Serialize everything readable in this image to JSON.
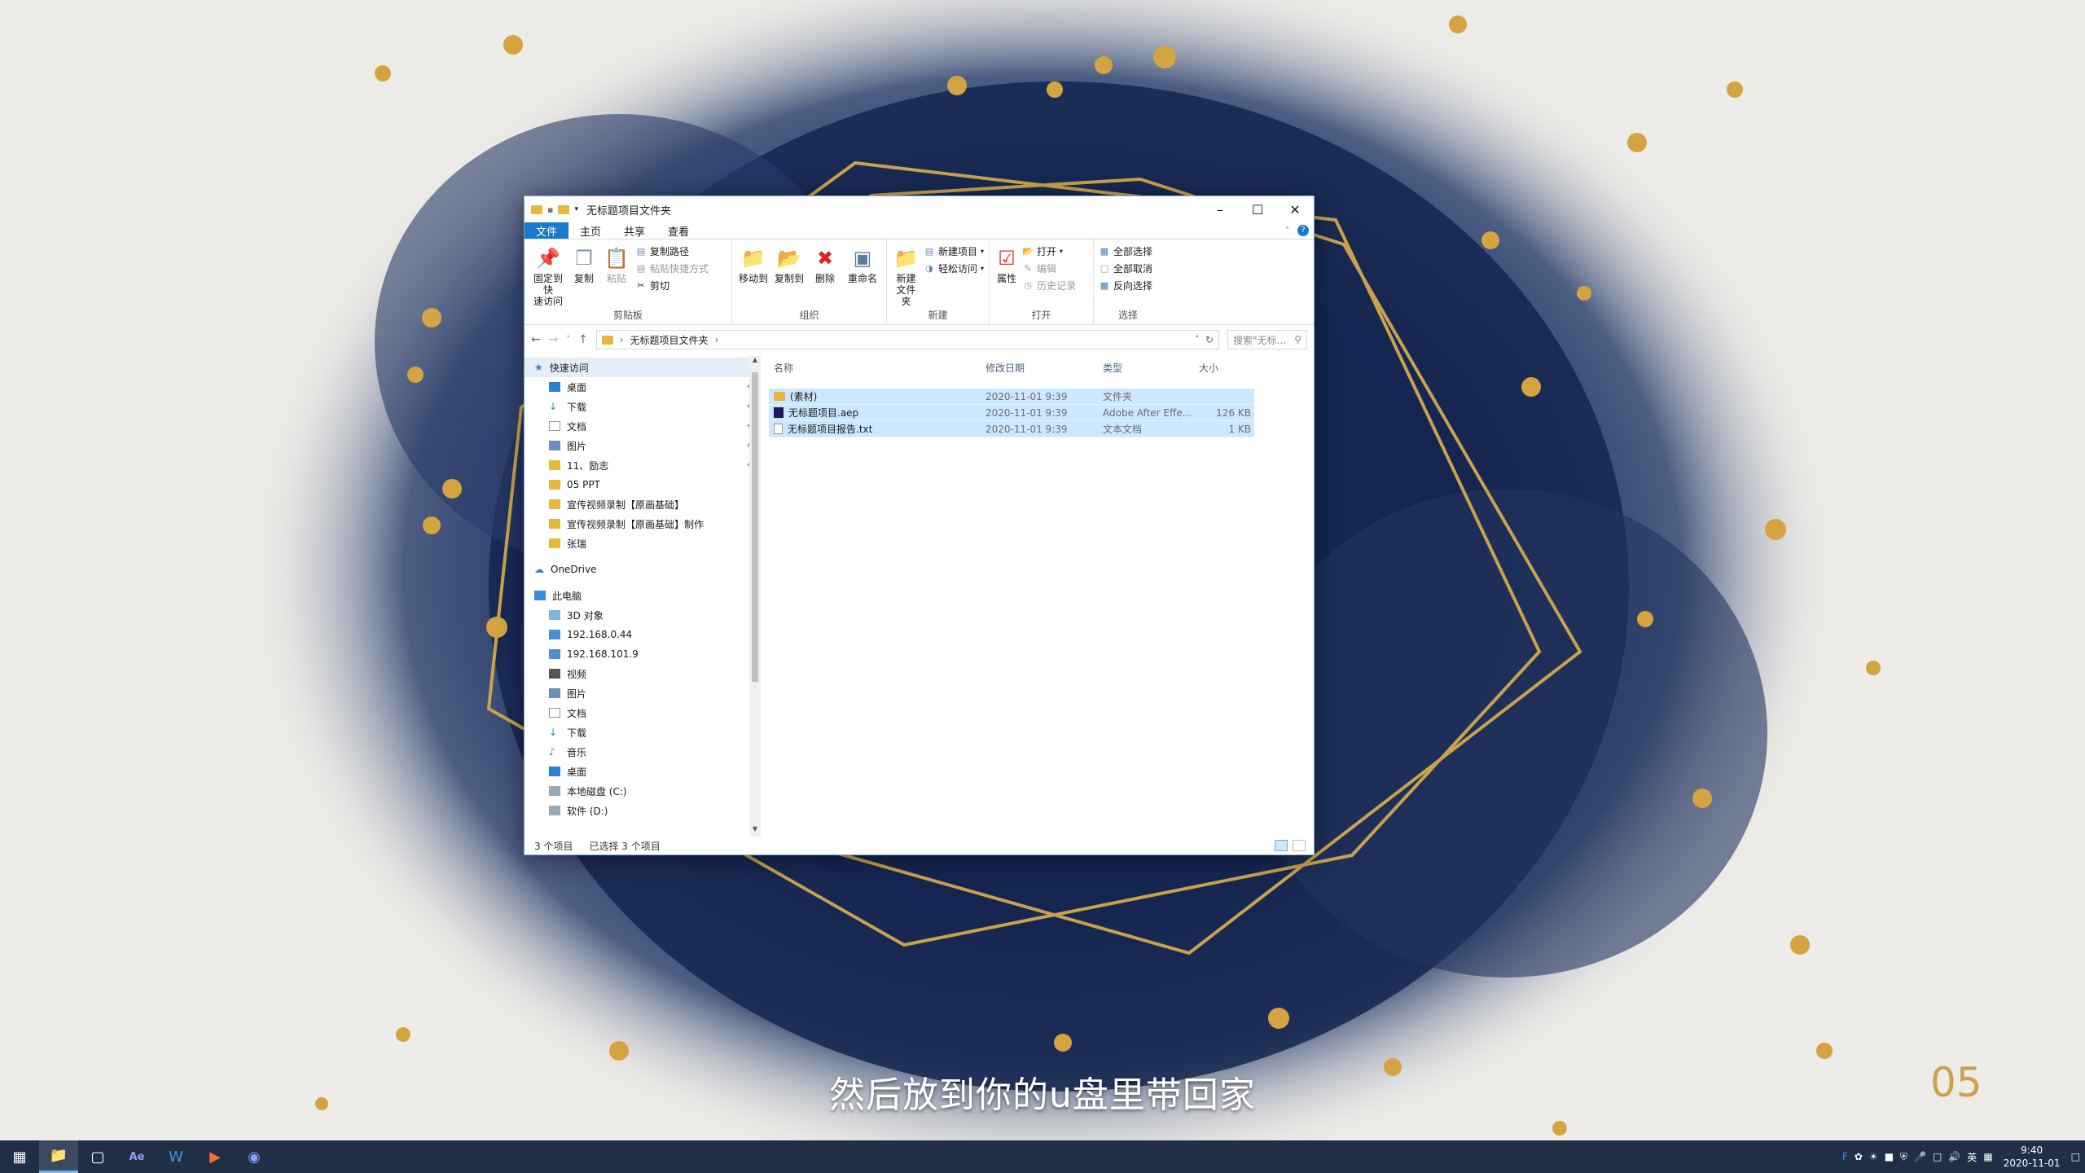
{
  "window": {
    "title": "无标题项目文件夹",
    "tabs": [
      "文件",
      "主页",
      "共享",
      "查看"
    ]
  },
  "ribbon": {
    "clipboard": {
      "label": "剪贴板",
      "pin": "固定到快\n速访问",
      "copy": "复制",
      "paste": "粘贴",
      "copy_path": "复制路径",
      "paste_shortcut": "粘贴快捷方式",
      "cut": "剪切"
    },
    "organize": {
      "label": "组织",
      "move_to": "移动到",
      "copy_to": "复制到",
      "delete": "删除",
      "rename": "重命名"
    },
    "new": {
      "label": "新建",
      "new_folder": "新建\n文件夹",
      "new_item": "新建项目",
      "easy_access": "轻松访问"
    },
    "open": {
      "label": "打开",
      "properties": "属性",
      "open": "打开",
      "edit": "编辑",
      "history": "历史记录"
    },
    "select": {
      "label": "选择",
      "select_all": "全部选择",
      "select_none": "全部取消",
      "invert": "反向选择"
    }
  },
  "address": {
    "path": "无标题项目文件夹",
    "search_placeholder": "搜索\"无标..."
  },
  "nav": {
    "quick_access": "快速访问",
    "quick_items": [
      "桌面",
      "下载",
      "文档",
      "图片",
      "11、励志",
      "05 PPT",
      "宣传视频录制【原画基础】",
      "宣传视频录制【原画基础】制作",
      "张瑞"
    ],
    "onedrive": "OneDrive",
    "this_pc": "此电脑",
    "pc_items": [
      "3D 对象",
      "192.168.0.44",
      "192.168.101.9",
      "视频",
      "图片",
      "文档",
      "下载",
      "音乐",
      "桌面",
      "本地磁盘 (C:)",
      "软件 (D:)"
    ]
  },
  "columns": {
    "name": "名称",
    "date": "修改日期",
    "type": "类型",
    "size": "大小"
  },
  "files": [
    {
      "name": "(素材)",
      "date": "2020-11-01 9:39",
      "type": "文件夹",
      "size": "",
      "icon": "folder-icon"
    },
    {
      "name": "无标题项目.aep",
      "date": "2020-11-01 9:39",
      "type": "Adobe After Effe...",
      "size": "126 KB",
      "icon": "aep-file-icon"
    },
    {
      "name": "无标题项目报告.txt",
      "date": "2020-11-01 9:39",
      "type": "文本文档",
      "size": "1 KB",
      "icon": "txt-file-icon"
    }
  ],
  "status": {
    "count": "3 个项目",
    "selected": "已选择 3 个项目"
  },
  "overlay": {
    "subtitle": "然后放到你的u盘里带回家",
    "page_number": "05"
  },
  "taskbar": {
    "ime": "英",
    "time": "9:40",
    "date": "2020-11-01"
  },
  "colors": {
    "accent": "#1979ca",
    "selection": "#cce8ff",
    "gold": "#c9a24a",
    "navy": "#14264f"
  }
}
